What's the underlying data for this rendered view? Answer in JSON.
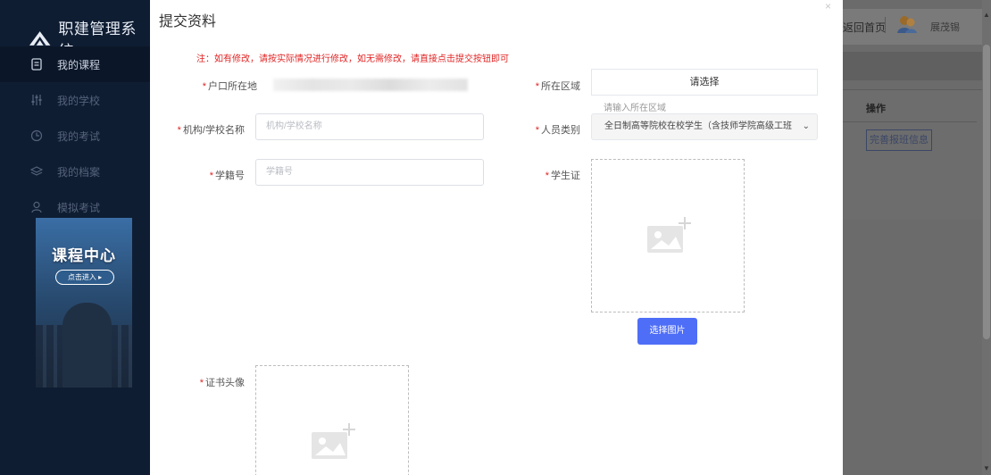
{
  "app": {
    "title": "职建管理系统"
  },
  "sidebar": {
    "items": [
      {
        "label": "我的课程",
        "icon": "document-icon",
        "active": true
      },
      {
        "label": "我的学校",
        "icon": "sliders-icon",
        "active": false
      },
      {
        "label": "我的考试",
        "icon": "clock-icon",
        "active": false
      },
      {
        "label": "我的档案",
        "icon": "layers-icon",
        "active": false
      },
      {
        "label": "模拟考试",
        "icon": "user-icon",
        "active": false
      }
    ],
    "banner": {
      "title": "课程中心",
      "button": "点击进入 ▸"
    }
  },
  "background": {
    "home_link": "返回首页",
    "user_name": "展茂锡",
    "table_header_action": "操作",
    "row_action": "完善报班信息"
  },
  "modal": {
    "title": "提交资料",
    "close": "×",
    "notice": "注：如有修改，请按实际情况进行修改，如无需修改，请直接点击提交按钮即可",
    "fields": {
      "hukou": {
        "label": "户口所在地",
        "required": true
      },
      "school": {
        "label": "机构/学校名称",
        "required": true,
        "placeholder": "机构/学校名称"
      },
      "student_no": {
        "label": "学籍号",
        "required": true,
        "placeholder": "学籍号"
      },
      "region": {
        "label": "所在区域",
        "required": true,
        "button": "请选择",
        "hint": "请输入所在区域"
      },
      "category": {
        "label": "人员类别",
        "required": true,
        "value": "全日制高等院校在校学生（含技师学院高级工班"
      },
      "student_card": {
        "label": "学生证",
        "required": true,
        "pick_button": "选择图片"
      },
      "cert_photo": {
        "label": "证书头像",
        "required": true
      }
    }
  },
  "colors": {
    "sidebar_bg": "#0f1d33",
    "required": "#e02424",
    "primary_button": "#4f6ef7"
  }
}
